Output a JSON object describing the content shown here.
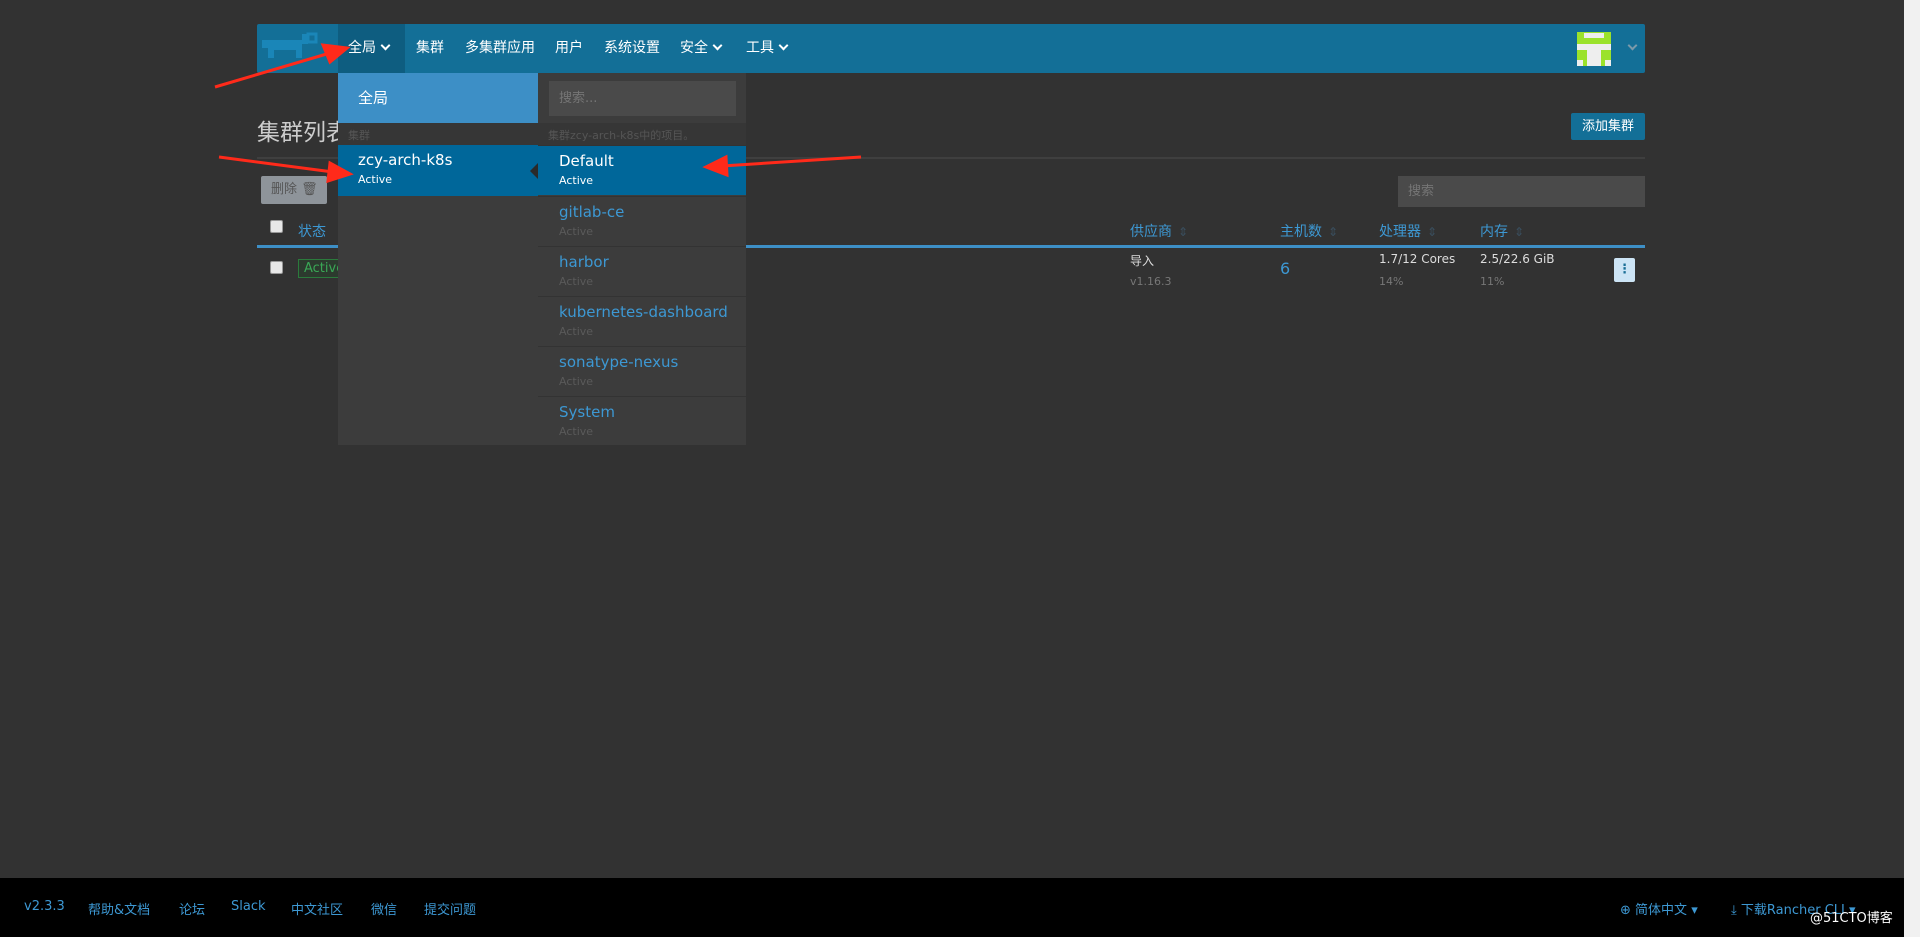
{
  "nav": {
    "items": [
      {
        "label": "全局",
        "icon": "chevron-down-icon"
      },
      {
        "label": "集群"
      },
      {
        "label": "多集群应用"
      },
      {
        "label": "用户"
      },
      {
        "label": "系统设置"
      },
      {
        "label": "安全",
        "icon": "chevron-down-icon"
      },
      {
        "label": "工具",
        "icon": "chevron-down-icon"
      }
    ]
  },
  "page": {
    "title": "集群列表",
    "add_button": "添加集群",
    "delete_button": "删除",
    "search_placeholder": "搜索"
  },
  "table": {
    "headers": [
      "状态",
      "供应商",
      "主机数",
      "处理器",
      "内存"
    ],
    "rows": [
      {
        "state": "Active",
        "provider": "导入",
        "version": "v1.16.3",
        "nodes": "6",
        "cpu": "1.7/12 Cores",
        "cpu_pct": "14%",
        "mem": "2.5/22.6 GiB",
        "mem_pct": "11%"
      }
    ]
  },
  "dropdown": {
    "global": "全局",
    "search_placeholder": "搜索...",
    "cluster_header": "集群",
    "project_header": "集群zcy-arch-k8s中的项目。",
    "cluster": {
      "name": "zcy-arch-k8s",
      "state": "Active"
    },
    "projects": [
      {
        "name": "Default",
        "state": "Active",
        "selected": true
      },
      {
        "name": "gitlab-ce",
        "state": "Active"
      },
      {
        "name": "harbor",
        "state": "Active"
      },
      {
        "name": "kubernetes-dashboard",
        "state": "Active"
      },
      {
        "name": "sonatype-nexus",
        "state": "Active"
      },
      {
        "name": "System",
        "state": "Active"
      }
    ]
  },
  "footer": {
    "links": [
      "v2.3.3",
      "帮助&文档",
      "论坛",
      "Slack",
      "中文社区",
      "微信",
      "提交问题"
    ],
    "language": "简体中文",
    "download": "下载Rancher CLI"
  },
  "watermark": "@51CTO博客",
  "colors": {
    "navbar": "#136f97",
    "accent": "#3d98d3",
    "selected": "#00679a",
    "annotation": "#ff2a1a"
  }
}
